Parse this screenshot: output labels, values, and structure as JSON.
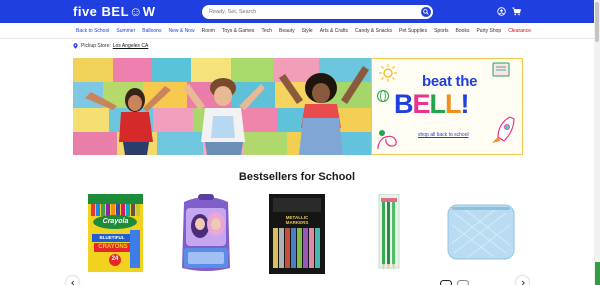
{
  "header": {
    "logo": "five BEL☺W",
    "search_placeholder": "Ready, Set, Search",
    "brand_color": "#1f3fe0"
  },
  "categories": [
    {
      "label": "Back to School",
      "style": "blue"
    },
    {
      "label": "Summer",
      "style": "blue"
    },
    {
      "label": "Balloons",
      "style": "blue"
    },
    {
      "label": "New & Now",
      "style": "blue"
    },
    {
      "label": "Room",
      "style": "dark"
    },
    {
      "label": "Toys & Games",
      "style": "dark"
    },
    {
      "label": "Tech",
      "style": "dark"
    },
    {
      "label": "Beauty",
      "style": "dark"
    },
    {
      "label": "Style",
      "style": "dark"
    },
    {
      "label": "Arts & Crafts",
      "style": "dark"
    },
    {
      "label": "Candy & Snacks",
      "style": "dark"
    },
    {
      "label": "Pet Supplies",
      "style": "dark"
    },
    {
      "label": "Sports",
      "style": "dark"
    },
    {
      "label": "Books",
      "style": "dark"
    },
    {
      "label": "Party Shop",
      "style": "dark"
    },
    {
      "label": "Clearance",
      "style": "red"
    }
  ],
  "pickup": {
    "label": "Pickup Store:",
    "store": "Los Angeles CA"
  },
  "hero": {
    "headline_top": "beat the",
    "headline_letters": [
      "B",
      "E",
      "L",
      "L",
      "!"
    ],
    "headline_colors": [
      "#1f3fe0",
      "#e8338a",
      "#1fa64a",
      "#f28c1b",
      "#1f3fe0"
    ],
    "link": "shop all back to school"
  },
  "section": {
    "title": "Bestsellers for School"
  },
  "products": [
    {
      "name": "Crayola Bluetiful Crayons 24",
      "brand": "Crayola",
      "line1": "BLUETIFUL",
      "line2": "CRAYONS",
      "count": "24",
      "icon": "crayon-box-icon"
    },
    {
      "name": "Character backpack",
      "icon": "backpack-icon"
    },
    {
      "name": "Metallic Markers",
      "line1": "METALLIC",
      "line2": "MARKERS",
      "icon": "marker-set-icon"
    },
    {
      "name": "Pencils pack",
      "icon": "pencil-pack-icon"
    },
    {
      "name": "Quilted pencil pouch",
      "icon": "pouch-icon"
    }
  ],
  "carousel": {
    "prev_icon": "chevron-left-icon",
    "next_icon": "chevron-right-icon",
    "dots": 2,
    "active_dot": 0
  }
}
